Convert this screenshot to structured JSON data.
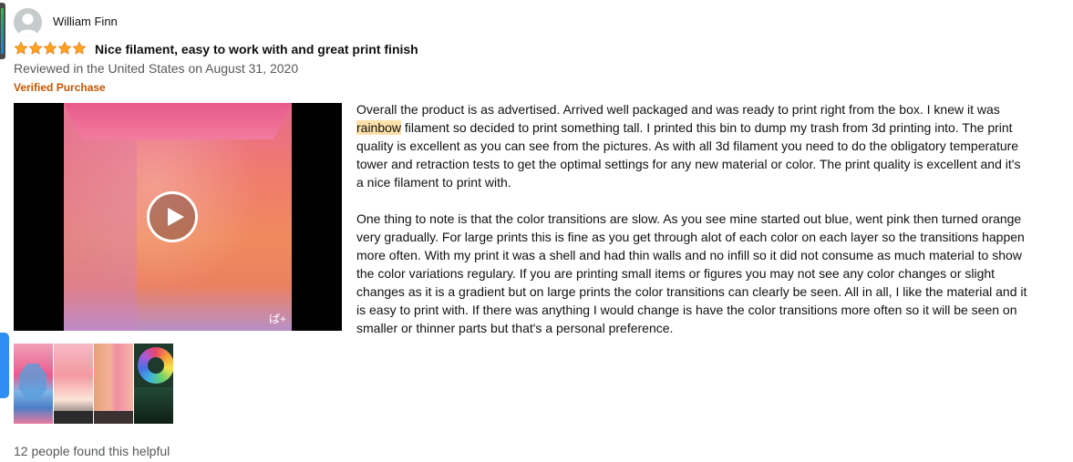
{
  "review": {
    "reviewer_name": "William Finn",
    "rating": 5,
    "rating_max": 5,
    "title": "Nice filament, easy to work with and great print finish",
    "reviewed_line": "Reviewed in the United States on August 31, 2020",
    "verified_label": "Verified Purchase",
    "body": {
      "p1_before": " Overall the product is as advertised. Arrived well packaged and was ready to print right from the box. I knew it was ",
      "p1_highlight": "rainbow",
      "p1_after": " filament so decided to print something tall. I printed this bin to dump my trash from 3d printing into. The print quality is excellent as you can see from the pictures. As with all 3d filament you need to do the obligatory temperature tower and retraction tests to get the optimal settings for any new material or color. The print quality is excellent and it's a nice filament to print with.",
      "p2": "One thing to note is that the color transitions are slow. As you see mine started out blue, went pink then turned orange very gradually. For large prints this is fine as you get through alot of each color on each layer so the transitions happen more often. With my print it was a shell and had thin walls and no infill so it did not consume as much material to show the color variations regulary. If you are printing small items or figures you may not see any color changes or slight changes as it is a gradient but on large prints the color transitions can clearly be seen. All in all, I like the material and it is easy to print with. If there was anything I would change is have the color transitions more often so it will be seen on smaller or thinner parts but that's a personal preference."
    },
    "helpful_text": "12 people found this helpful"
  },
  "video": {
    "watermark": "ぱ+"
  },
  "colors": {
    "star": "#ffa41c",
    "verified": "#c45500",
    "highlight": "#ffe0a8",
    "edge_tab": "#2f8ef4"
  },
  "icons": {
    "avatar": "user-avatar-icon",
    "play": "play-icon",
    "star": "star-icon"
  }
}
